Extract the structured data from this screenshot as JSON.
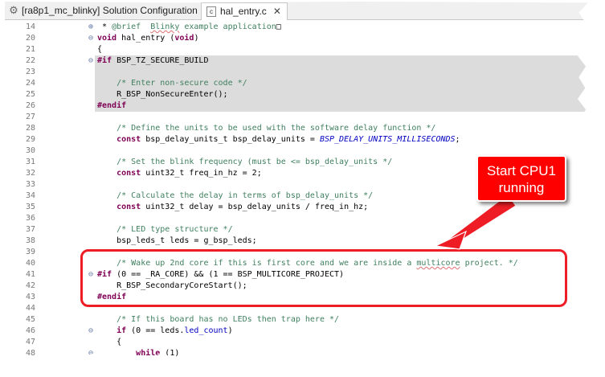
{
  "tabs": [
    {
      "label": "[ra8p1_mc_blinky] Solution Configuration",
      "icon": "gear-icon",
      "active": false
    },
    {
      "label": "hal_entry.c",
      "icon": "c-file-icon",
      "active": true,
      "close": "✕"
    }
  ],
  "callout": {
    "line1": "Start CPU1",
    "line2": "running",
    "color": "#ff0000"
  },
  "highlight_color": "#ee1c24",
  "code_lines": [
    {
      "num": "14",
      "fold": "⊕",
      "html": " * <span class=\"cm\">@brief  <span class=\"sq\">Blinky</span> example application</span>□"
    },
    {
      "num": "20",
      "fold": "⊖",
      "html": "<span class=\"kw\">void</span> hal_entry (<span class=\"kw\">void</span>)"
    },
    {
      "num": "21",
      "fold": "",
      "html": "{"
    },
    {
      "num": "22",
      "fold": "⊖",
      "html": "<span class=\"kw\">#if</span> BSP_TZ_SECURE_BUILD"
    },
    {
      "num": "23",
      "fold": "",
      "html": ""
    },
    {
      "num": "24",
      "fold": "",
      "html": "    <span class=\"cm\">/* Enter non-secure code */</span>"
    },
    {
      "num": "25",
      "fold": "",
      "html": "    R_BSP_NonSecureEnter();"
    },
    {
      "num": "26",
      "fold": "",
      "html": "<span class=\"kw\">#endif</span>"
    },
    {
      "num": "27",
      "fold": "",
      "html": ""
    },
    {
      "num": "28",
      "fold": "",
      "html": "    <span class=\"cm\">/* Define the units to be used with the software delay function */</span>"
    },
    {
      "num": "29",
      "fold": "",
      "html": "    <span class=\"kw\">const</span> bsp_delay_units_t bsp_delay_units = <span class=\"mc\">BSP_DELAY_UNITS_MILLISECONDS</span>;"
    },
    {
      "num": "30",
      "fold": "",
      "html": ""
    },
    {
      "num": "31",
      "fold": "",
      "html": "    <span class=\"cm\">/* Set the blink frequency (must be &lt;= bsp_delay_units */</span>"
    },
    {
      "num": "32",
      "fold": "",
      "html": "    <span class=\"kw\">const</span> uint32_t freq_in_hz = 2;"
    },
    {
      "num": "33",
      "fold": "",
      "html": ""
    },
    {
      "num": "34",
      "fold": "",
      "html": "    <span class=\"cm\">/* Calculate the delay in terms of bsp_delay_units */</span>"
    },
    {
      "num": "35",
      "fold": "",
      "html": "    <span class=\"kw\">const</span> uint32_t delay = bsp_delay_units / freq_in_hz;"
    },
    {
      "num": "36",
      "fold": "",
      "html": ""
    },
    {
      "num": "37",
      "fold": "",
      "html": "    <span class=\"cm\">/* LED type structure */</span>"
    },
    {
      "num": "38",
      "fold": "",
      "html": "    bsp_leds_t leds = g_bsp_leds;"
    },
    {
      "num": "39",
      "fold": "",
      "html": ""
    },
    {
      "num": "40",
      "fold": "",
      "html": "    <span class=\"cm\">/* Wake up 2nd core if this is first core and we are inside a <span class=\"sq\">multicore</span> project. */</span>"
    },
    {
      "num": "41",
      "fold": "⊖",
      "html": "<span class=\"kw\">#if</span> (0 == _RA_CORE) &amp;&amp; (1 == BSP_MULTICORE_PROJECT)"
    },
    {
      "num": "42",
      "fold": "",
      "html": "    R_BSP_SecondaryCoreStart();"
    },
    {
      "num": "43",
      "fold": "",
      "html": "<span class=\"kw\">#endif</span>"
    },
    {
      "num": "44",
      "fold": "",
      "html": ""
    },
    {
      "num": "45",
      "fold": "",
      "html": "    <span class=\"cm\">/* If this board has no LEDs then trap here */</span>"
    },
    {
      "num": "46",
      "fold": "⊖",
      "html": "    <span class=\"kw\">if</span> (0 == leds.<span class=\"fd\">led_count</span>)"
    },
    {
      "num": "47",
      "fold": "",
      "html": "    {"
    },
    {
      "num": "48",
      "fold": "⊖",
      "html": "        <span class=\"kw\">while</span> (1)"
    }
  ]
}
